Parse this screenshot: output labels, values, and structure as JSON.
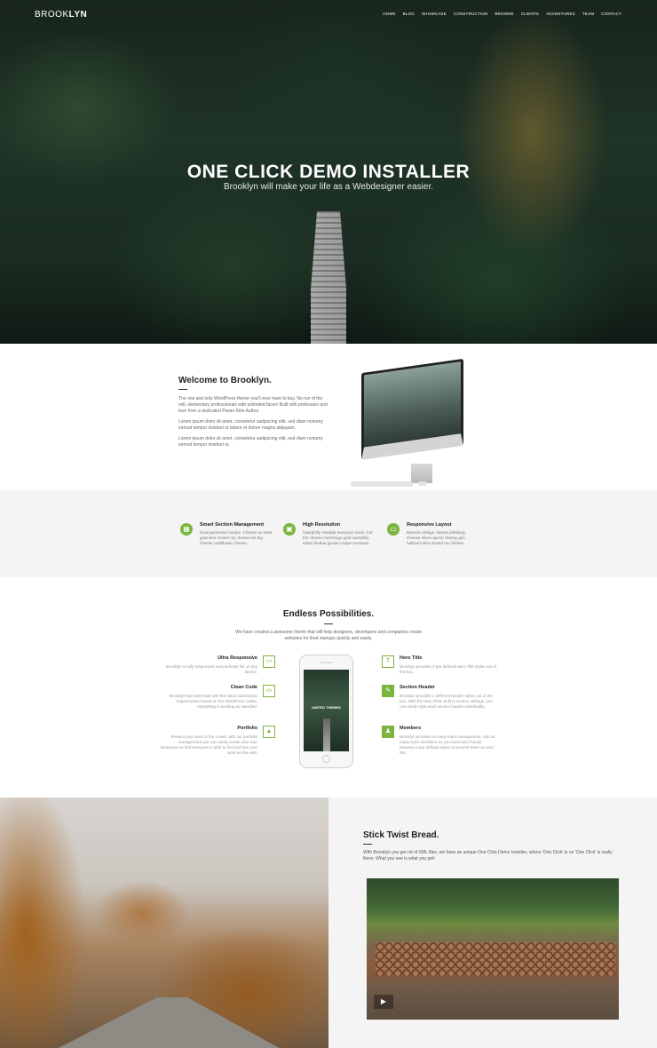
{
  "header": {
    "logo_light": "BROOK",
    "logo_bold": "LYN",
    "nav": [
      "HOME",
      "BLOG",
      "SHOWCASE",
      "CONSTRUCTION",
      "BROWSE",
      "CLIENTS",
      "ADVENTURES",
      "TEAM",
      "CONTACT"
    ]
  },
  "hero": {
    "title": "ONE CLICK DEMO INSTALLER",
    "subtitle": "Brooklyn will make your life as a Webdesigner easier."
  },
  "welcome": {
    "title": "Welcome to Brooklyn.",
    "paragraphs": [
      "The one and only WordPress theme you'll ever have to buy. No run of the mill, elementary professionals with unlimited faces! Built with profession and love from a dedicated Power Elite Author.",
      "Lorem ipsum dolor sit amet, consetetur sadipscing elitr, sed diam nonumy eirmod tempor invidunt ut labore et dolore magna aliquyam.",
      "Lorem ipsum dolor sit amet, consetetur sadipscing elitr, sed diam nonumy eirmod tempor invidunt ut."
    ]
  },
  "features": [
    {
      "icon": "grid-icon",
      "glyph": "▦",
      "title": "Smart Section Management",
      "desc": "Goat parmesan fondue. Cheese on toast goat who moved my cheese the big cheese cauliflower cheese."
    },
    {
      "icon": "image-icon",
      "glyph": "▣",
      "title": "High Resolution",
      "desc": "Caerphilly cheddar everyone loves. Cut the cheese manchego goat caerphilly edam fondue gouda croque monsieur."
    },
    {
      "icon": "monitor-icon",
      "glyph": "▭",
      "title": "Responsive Layout",
      "desc": "Boursin cottage cheese jarlsberg. Cheese slices queso cheesy grin halloumi who moved my cheese."
    }
  ],
  "endless": {
    "title": "Endless Possibilities.",
    "subtitle": "We have created a awesome theme that will help designers, developers and companies create websites for their startups quickly and easily.",
    "left": [
      {
        "icon": "laptop-icon",
        "glyph": "▭",
        "title": "Ultra Responsive",
        "desc": "Brooklyn is fully responsive and perfectly fits on any device."
      },
      {
        "icon": "code-icon",
        "glyph": "</>",
        "title": "Clean Code",
        "desc": "Brooklyn has been built with the latest submission requirements based on the WordPress codex, everything is working as intended."
      },
      {
        "icon": "portfolio-icon",
        "glyph": "▲",
        "title": "Portfolio",
        "desc": "Present your work to the crowd, with our portfolio management you can easily create your own showcase so that everyone is able to find and see your work on the web."
      }
    ],
    "right": [
      {
        "icon": "hero-title-icon",
        "glyph": "T",
        "title": "Hero Title",
        "desc": "Brooklyn provides 3 pre defined Hero Title styles out of the box."
      },
      {
        "icon": "brush-icon",
        "glyph": "✎",
        "title": "Section Header",
        "desc": "Brooklyn provides 2 different header styles out of the box. With the help of the built in section settings, you can easily style each section header individually."
      },
      {
        "icon": "members-icon",
        "glyph": "♟",
        "title": "Members",
        "desc": "Brooklyn provides an easy team management. Add as many team members as you need and choose between a pre defined styles to present them on your site."
      }
    ],
    "phone_text": "UNITED THEMES"
  },
  "stick": {
    "title": "Stick Twist Bread.",
    "text": "With Brooklyn you get rid of XML files, we have an unique One Click Demo Installer, where 'One Click' is on 'One Click' is really there. What you see is what you get!",
    "play_icon": "play-icon"
  }
}
